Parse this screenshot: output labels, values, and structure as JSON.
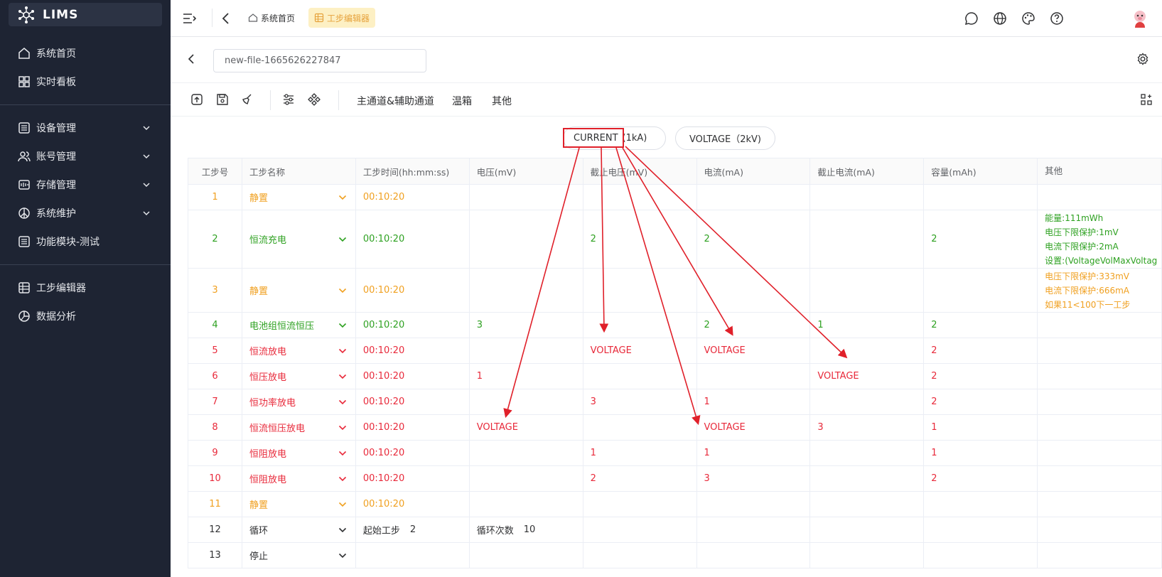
{
  "app": {
    "title": "LIMS"
  },
  "sidebar": {
    "items": [
      {
        "label": "系统首页"
      },
      {
        "label": "实时看板"
      },
      {
        "label": "设备管理"
      },
      {
        "label": "账号管理"
      },
      {
        "label": "存储管理"
      },
      {
        "label": "系统维护"
      },
      {
        "label": "功能模块-测试"
      },
      {
        "label": "工步编辑器"
      },
      {
        "label": "数据分析"
      }
    ]
  },
  "topbar": {
    "tabs": [
      {
        "label": "系统首页"
      },
      {
        "label": "工步编辑器"
      }
    ]
  },
  "editor": {
    "filename": "new-file-1665626227847"
  },
  "toolbar": {
    "tabs": [
      "主通道&辅助通道",
      "温箱",
      "其他"
    ]
  },
  "channels": {
    "current_label": "CURRENT",
    "current_range": "(1kA)",
    "voltage_label": "VOLTAGE（2kV)"
  },
  "table": {
    "headers": [
      "工步号",
      "工步名称",
      "工步时间(hh:mm:ss)",
      "电压(mV)",
      "截止电压(mV)",
      "电流(mA)",
      "截止电流(mA)",
      "容量(mAh)",
      "其他"
    ],
    "rows": [
      {
        "no": "1",
        "name": "静置",
        "time": "00:10:20",
        "v": "",
        "cv": "",
        "i": "",
        "ci": "",
        "cap": "",
        "other": []
      },
      {
        "no": "2",
        "name": "恒流充电",
        "time": "00:10:20",
        "v": "",
        "cv": "2",
        "i": "2",
        "ci": "",
        "cap": "2",
        "other": [
          "能量:111mWh",
          "电压下限保护:1mV",
          "电流下限保护:2mA",
          "设置:(VoltageVolMaxVoltag"
        ]
      },
      {
        "no": "3",
        "name": "静置",
        "time": "00:10:20",
        "v": "",
        "cv": "",
        "i": "",
        "ci": "",
        "cap": "",
        "other": [
          "电压下限保护:333mV",
          "电流下限保护:666mA",
          "如果11<100下一工步"
        ]
      },
      {
        "no": "4",
        "name": "电池组恒流恒压",
        "time": "00:10:20",
        "v": "3",
        "cv": "",
        "i": "2",
        "ci": "1",
        "cap": "2",
        "other": []
      },
      {
        "no": "5",
        "name": "恒流放电",
        "time": "00:10:20",
        "v": "",
        "cv": "VOLTAGE",
        "i": "VOLTAGE",
        "ci": "",
        "cap": "2",
        "other": []
      },
      {
        "no": "6",
        "name": "恒压放电",
        "time": "00:10:20",
        "v": "1",
        "cv": "",
        "i": "",
        "ci": "VOLTAGE",
        "cap": "2",
        "other": []
      },
      {
        "no": "7",
        "name": "恒功率放电",
        "time": "00:10:20",
        "v": "",
        "cv": "3",
        "i": "1",
        "ci": "",
        "cap": "2",
        "other": []
      },
      {
        "no": "8",
        "name": "恒流恒压放电",
        "time": "00:10:20",
        "v": "VOLTAGE",
        "cv": "",
        "i": "VOLTAGE",
        "ci": "3",
        "cap": "1",
        "other": []
      },
      {
        "no": "9",
        "name": "恒阻放电",
        "time": "00:10:20",
        "v": "",
        "cv": "1",
        "i": "1",
        "ci": "",
        "cap": "1",
        "other": []
      },
      {
        "no": "10",
        "name": "恒阻放电",
        "time": "00:10:20",
        "v": "",
        "cv": "2",
        "i": "3",
        "ci": "",
        "cap": "2",
        "other": []
      },
      {
        "no": "11",
        "name": "静置",
        "time": "00:10:20",
        "v": "",
        "cv": "",
        "i": "",
        "ci": "",
        "cap": "",
        "other": []
      }
    ],
    "loop_row": {
      "no": "12",
      "name": "循环",
      "start_label": "起始工步",
      "start_value": "2",
      "count_label": "循环次数",
      "count_value": "10"
    },
    "stop_row": {
      "no": "13",
      "name": "停止"
    }
  },
  "colors": {
    "rest": "#f0a020",
    "charge": "#2ea121",
    "discharge": "#e8293a",
    "annotation": "#e0202a"
  }
}
